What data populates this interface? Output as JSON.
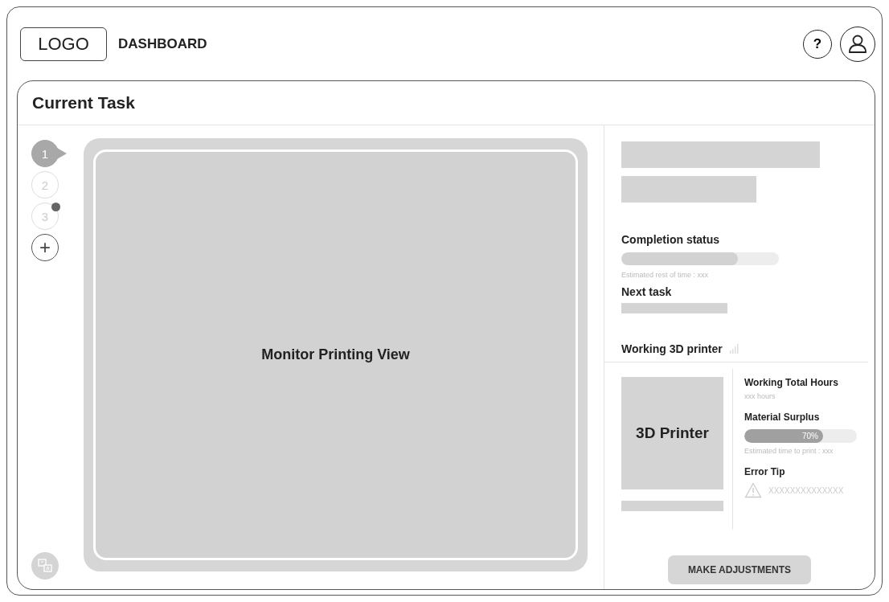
{
  "header": {
    "logo": "LOGO",
    "title": "DASHBOARD",
    "help": "?"
  },
  "card": {
    "title": "Current Task"
  },
  "steps": [
    {
      "label": "1",
      "selected": true,
      "notification": false
    },
    {
      "label": "2",
      "selected": false,
      "notification": false
    },
    {
      "label": "3",
      "selected": false,
      "notification": true
    }
  ],
  "add_step": "+",
  "monitor": {
    "label": "Monitor Printing View"
  },
  "status": {
    "completion_title": "Completion status",
    "level": 0.74,
    "estimate": "Estimated rest of time : xxx",
    "next_title": "Next task",
    "printer_title": "Working 3D printer"
  },
  "printer": {
    "label": "3D Printer",
    "hours_title": "Working Total Hours",
    "hours": "xxx hours",
    "material_title": "Material Surplus",
    "material": {
      "level": 0.7,
      "reading": "70%"
    },
    "print_estimate": "Estimated time to print : xxx",
    "error_title": "Error Tip",
    "error_text": "XXXXXXXXXXXXXX"
  },
  "action": "MAKE ADJUSTMENTS"
}
